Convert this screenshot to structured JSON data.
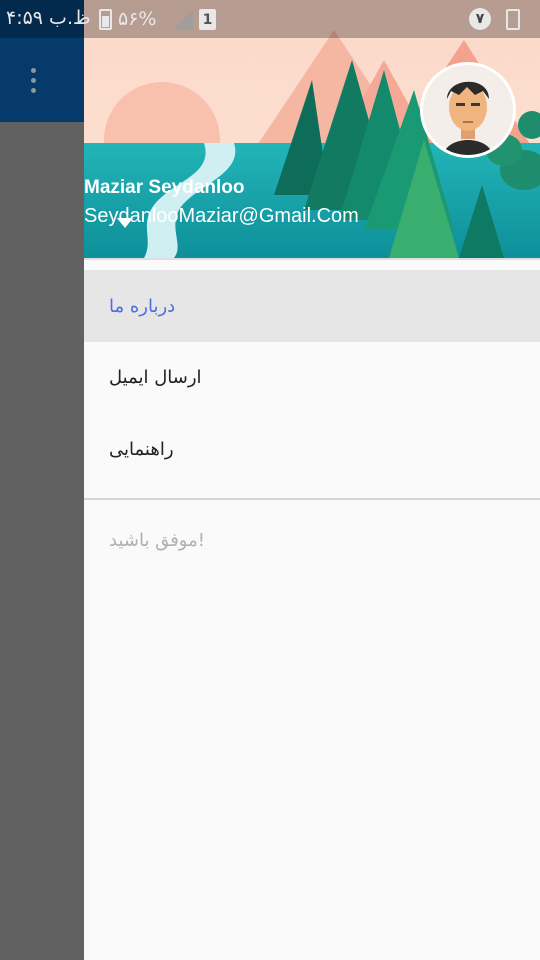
{
  "status_bar": {
    "time": "۴:۵۹ ب.ظ",
    "battery_percent": "۵۶%",
    "sim_slot": "1",
    "notification_count": "۷",
    "battery_icon": "battery-charging-icon",
    "signal_icon": "signal-icon",
    "phone_icon": "phone-icon"
  },
  "app": {
    "toolbar_color": "#053a6b",
    "overflow_icon": "more-vert-icon"
  },
  "drawer": {
    "header": {
      "name": "Maziar Seydanloo",
      "email": "SeydanlooMaziar@Gmail.Com",
      "avatar_icon": "avatar-icon",
      "dropdown_icon": "arrow-drop-down-icon"
    },
    "menu": [
      {
        "label": "درباره ما",
        "active": true
      },
      {
        "label": "ارسال ایمیل",
        "active": false
      },
      {
        "label": "راهنمایی",
        "active": false
      }
    ],
    "footer": "موفق باشید!",
    "active_color": "#4a6fe0"
  }
}
